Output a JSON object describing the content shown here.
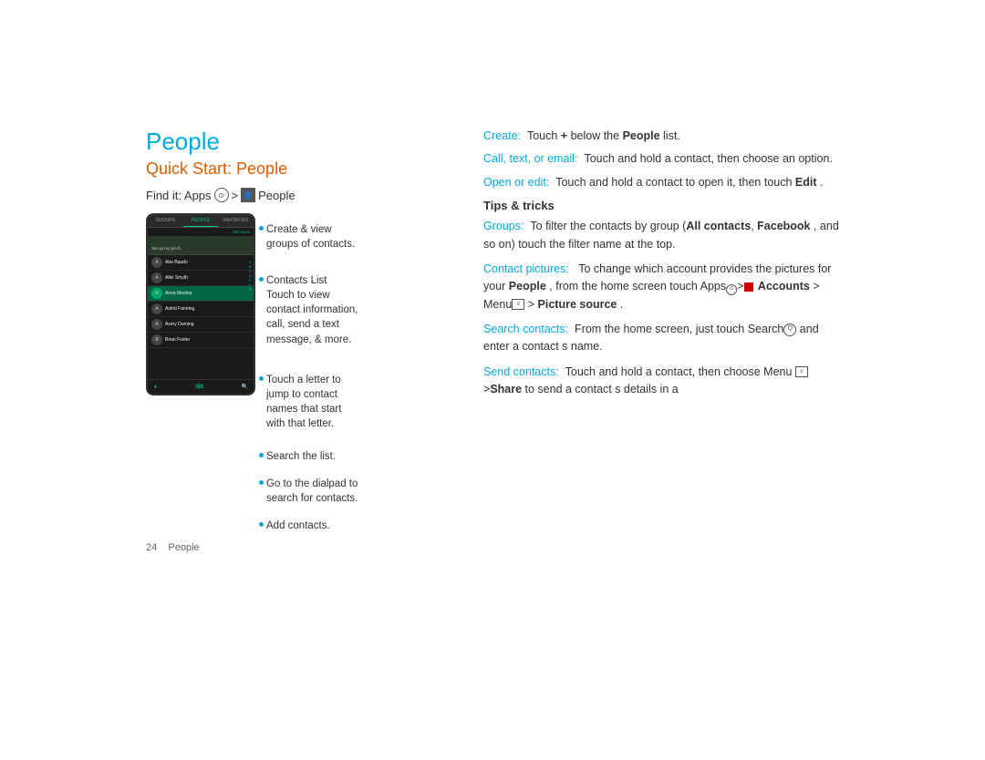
{
  "page": {
    "background": "#ffffff"
  },
  "left": {
    "main_title": "People",
    "subtitle": "Quick Start: People",
    "find_it_prefix": "Find it: Apps",
    "find_it_suffix": "People",
    "phone": {
      "tabs": [
        "GROUPS",
        "PEOPLE",
        "FAVORITES"
      ],
      "active_tab": "PEOPLE",
      "header_right": "SEP 20/21",
      "setup_text": "Set up my pro fi...",
      "contacts": [
        {
          "name": "Abe Baudo",
          "highlighted": false
        },
        {
          "name": "Allie Smyth",
          "highlighted": false
        },
        {
          "name": "Anna Medina",
          "highlighted": true
        },
        {
          "name": "Astrid Fanning",
          "highlighted": false
        },
        {
          "name": "Avery Durning",
          "highlighted": false
        },
        {
          "name": "Brian Foster",
          "highlighted": false
        }
      ],
      "letters": [
        "A",
        "B",
        "C",
        "D",
        "E",
        "F",
        "G"
      ]
    },
    "callouts": [
      {
        "id": "callout-groups",
        "text": "Create & view\ngroups of contacts."
      },
      {
        "id": "callout-contacts-list",
        "text": "Contacts List\nTouch to view\ncontact information,\ncall, send a text\nmessage, & more."
      },
      {
        "id": "callout-letter",
        "text": "Touch a letter to\njump to contact\nnames that start\nwith that letter."
      },
      {
        "id": "callout-search",
        "text": "Search the list."
      },
      {
        "id": "callout-dialpad",
        "text": "Go to the dialpad to\nsearch for contacts."
      },
      {
        "id": "callout-add",
        "text": "Add contacts."
      }
    ],
    "page_number": "24",
    "page_label": "People"
  },
  "right": {
    "sections": [
      {
        "id": "create",
        "link_label": "Create:",
        "text": " Touch + below the ",
        "bold": "People",
        "text2": " list."
      },
      {
        "id": "call-text-email",
        "link_label": "Call, text, or email:",
        "text": " Touch and hold a contact, then choose an option."
      },
      {
        "id": "open-edit",
        "link_label": "Open or edit:",
        "text": " Touch and hold a contact to open it, then touch ",
        "bold": "Edit",
        "text2": " ."
      }
    ],
    "tips_heading": "Tips & tricks",
    "tips": [
      {
        "id": "tip-groups",
        "link_label": "Groups:",
        "text": " To filter the contacts by group (All contacts,  Facebook , and so on) touch the filter name at the top."
      },
      {
        "id": "tip-contact-pictures",
        "link_label": "Contact pictures:",
        "text": "  To change which account provides the pictures for your People , from the home screen touch Apps > Accounts > Menu > Picture source ."
      },
      {
        "id": "tip-search-contacts",
        "link_label": "Search contacts:",
        "text": " From the home screen, just touch Search and enter a contact s name."
      },
      {
        "id": "tip-send-contacts",
        "link_label": "Send contacts:",
        "text": " Touch and hold a contact, then choose Menu >Share to send a contact s details in a"
      }
    ]
  }
}
